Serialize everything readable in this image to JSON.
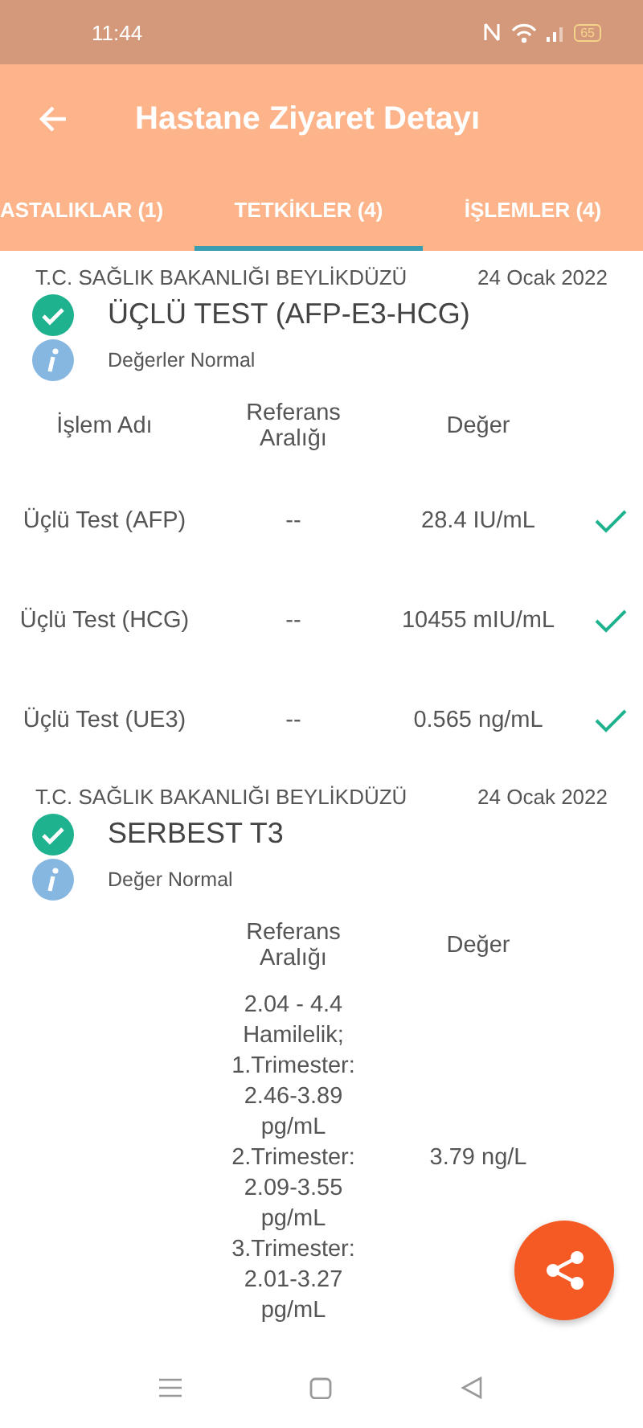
{
  "status_bar": {
    "time": "11:44",
    "battery": "65"
  },
  "app_bar": {
    "title": "Hastane Ziyaret Detayı"
  },
  "tabs": [
    {
      "label": "ASTALIKLAR (1)",
      "selected": false
    },
    {
      "label": "TETKİKLER (4)",
      "selected": true
    },
    {
      "label": "İŞLEMLER (4)",
      "selected": false
    }
  ],
  "tests": [
    {
      "institution": "T.C. SAĞLIK BAKANLIĞI BEYLİKDÜZÜ",
      "date": "24 Ocak 2022",
      "title": "ÜÇLÜ TEST (AFP-E3-HCG)",
      "note": "Değerler Normal",
      "columns": [
        "İşlem Adı",
        "Referans Aralığı",
        "Değer"
      ],
      "rows": [
        {
          "name": "Üçlü Test (AFP)",
          "reference": "--",
          "value": "28.4 IU/mL",
          "normal": true
        },
        {
          "name": "Üçlü Test (HCG)",
          "reference": "--",
          "value": "10455 mIU/mL",
          "normal": true
        },
        {
          "name": "Üçlü Test (UE3)",
          "reference": "--",
          "value": "0.565 ng/mL",
          "normal": true
        }
      ]
    },
    {
      "institution": "T.C. SAĞLIK BAKANLIĞI BEYLİKDÜZÜ",
      "date": "24 Ocak 2022",
      "title": "SERBEST T3",
      "note": "Değer Normal",
      "columns": [
        "",
        "Referans Aralığı",
        "Değer"
      ],
      "rows": [
        {
          "name": "",
          "reference": "2.04 - 4.4 Hamilelik; 1.Trimester: 2.46-3.89 pg/mL 2.Trimester: 2.09-3.55 pg/mL 3.Trimester: 2.01-3.27 pg/mL",
          "value": "3.79 ng/L",
          "normal": false
        }
      ]
    }
  ]
}
